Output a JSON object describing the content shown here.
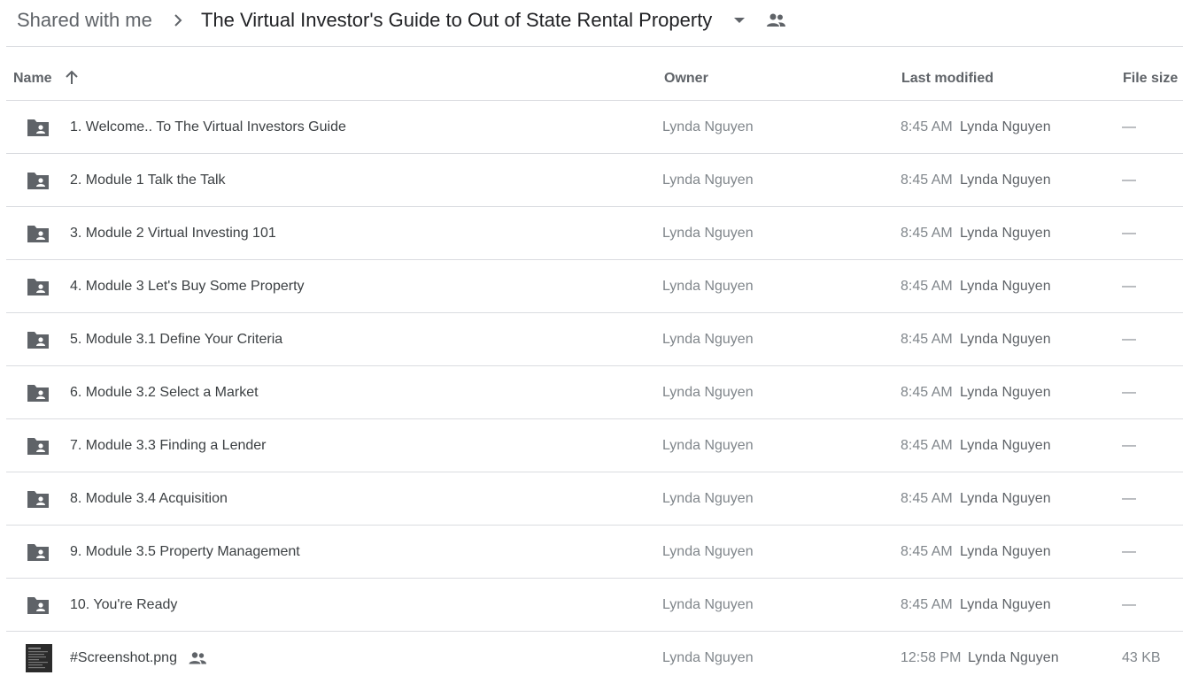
{
  "breadcrumb": {
    "root": "Shared with me",
    "separator_icon": "chevron-right-icon",
    "current": "The Virtual Investor's Guide to Out of State Rental Property",
    "dropdown_icon": "caret-down-icon",
    "shared_icon": "people-icon"
  },
  "columns": {
    "name": "Name",
    "sort_icon": "arrow-up-icon",
    "owner": "Owner",
    "last_modified": "Last modified",
    "file_size": "File size"
  },
  "colors": {
    "folder_icon": "#5f6368",
    "divider": "#dadce0",
    "text_primary": "#3c4043",
    "text_secondary": "#80868b"
  },
  "rows": [
    {
      "type": "folder",
      "icon": "shared-folder-icon",
      "name": "1. Welcome.. To The Virtual Investors Guide",
      "owner": "Lynda Nguyen",
      "time": "8:45 AM",
      "modified_by": "Lynda Nguyen",
      "size": "—"
    },
    {
      "type": "folder",
      "icon": "shared-folder-icon",
      "name": "2. Module 1 Talk the Talk",
      "owner": "Lynda Nguyen",
      "time": "8:45 AM",
      "modified_by": "Lynda Nguyen",
      "size": "—"
    },
    {
      "type": "folder",
      "icon": "shared-folder-icon",
      "name": "3. Module 2 Virtual Investing 101",
      "owner": "Lynda Nguyen",
      "time": "8:45 AM",
      "modified_by": "Lynda Nguyen",
      "size": "—"
    },
    {
      "type": "folder",
      "icon": "shared-folder-icon",
      "name": "4. Module 3 Let's Buy Some Property",
      "owner": "Lynda Nguyen",
      "time": "8:45 AM",
      "modified_by": "Lynda Nguyen",
      "size": "—"
    },
    {
      "type": "folder",
      "icon": "shared-folder-icon",
      "name": "5. Module 3.1 Define Your Criteria",
      "owner": "Lynda Nguyen",
      "time": "8:45 AM",
      "modified_by": "Lynda Nguyen",
      "size": "—"
    },
    {
      "type": "folder",
      "icon": "shared-folder-icon",
      "name": "6. Module 3.2 Select a Market",
      "owner": "Lynda Nguyen",
      "time": "8:45 AM",
      "modified_by": "Lynda Nguyen",
      "size": "—"
    },
    {
      "type": "folder",
      "icon": "shared-folder-icon",
      "name": "7. Module 3.3 Finding a Lender",
      "owner": "Lynda Nguyen",
      "time": "8:45 AM",
      "modified_by": "Lynda Nguyen",
      "size": "—"
    },
    {
      "type": "folder",
      "icon": "shared-folder-icon",
      "name": "8. Module 3.4 Acquisition",
      "owner": "Lynda Nguyen",
      "time": "8:45 AM",
      "modified_by": "Lynda Nguyen",
      "size": "—"
    },
    {
      "type": "folder",
      "icon": "shared-folder-icon",
      "name": "9. Module 3.5 Property Management",
      "owner": "Lynda Nguyen",
      "time": "8:45 AM",
      "modified_by": "Lynda Nguyen",
      "size": "—"
    },
    {
      "type": "folder",
      "icon": "shared-folder-icon",
      "name": "10. You're Ready",
      "owner": "Lynda Nguyen",
      "time": "8:45 AM",
      "modified_by": "Lynda Nguyen",
      "size": "—"
    },
    {
      "type": "file",
      "icon": "image-thumbnail-icon",
      "name": "#Screenshot.png",
      "shared": true,
      "owner": "Lynda Nguyen",
      "time": "12:58 PM",
      "modified_by": "Lynda Nguyen",
      "size": "43 KB"
    }
  ]
}
